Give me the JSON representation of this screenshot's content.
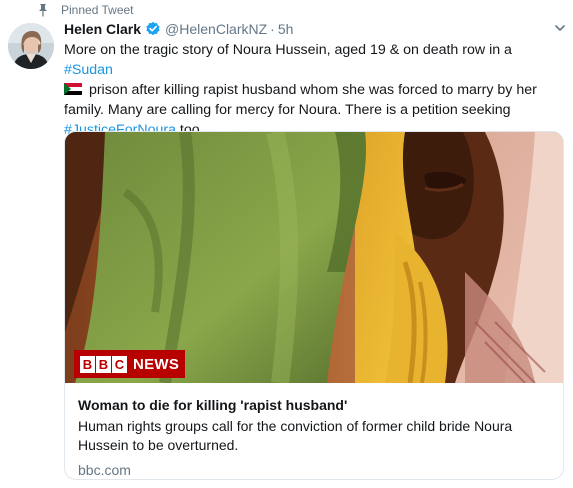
{
  "colors": {
    "link": "#1b95e0",
    "secondary_text": "#657786",
    "primary_text": "#14171a",
    "verified": "#1da1f2",
    "bbc_red": "#b80000"
  },
  "pinned": {
    "icon": "pin-icon",
    "label": "Pinned Tweet"
  },
  "author": {
    "avatar_icon": "avatar",
    "name": "Helen Clark",
    "verified_icon": "verified-badge-icon",
    "handle": "@HelenClarkNZ",
    "separator": "·",
    "time": "5h"
  },
  "menu_icon": "chevron-down-icon",
  "tweet": {
    "text_1": "More on the tragic story of Noura Hussein, aged 19 & on death row in a ",
    "hashtag_sudan": "#Sudan",
    "flag_icon": "sudan-flag-emoji",
    "text_2": " prison after killing rapist husband whom she was forced to marry by her family. Many are calling for mercy for Noura. There is a petition seeking ",
    "hashtag_justice": "#JusticeForNoura",
    "text_3": " too."
  },
  "card": {
    "badge": {
      "b1": "B",
      "b2": "B",
      "b3": "C",
      "news": "NEWS"
    },
    "title": "Woman to die for killing 'rapist husband'",
    "description": "Human rights groups call for the conviction of former child bride Noura Hussein to be overturned.",
    "domain": "bbc.com"
  }
}
